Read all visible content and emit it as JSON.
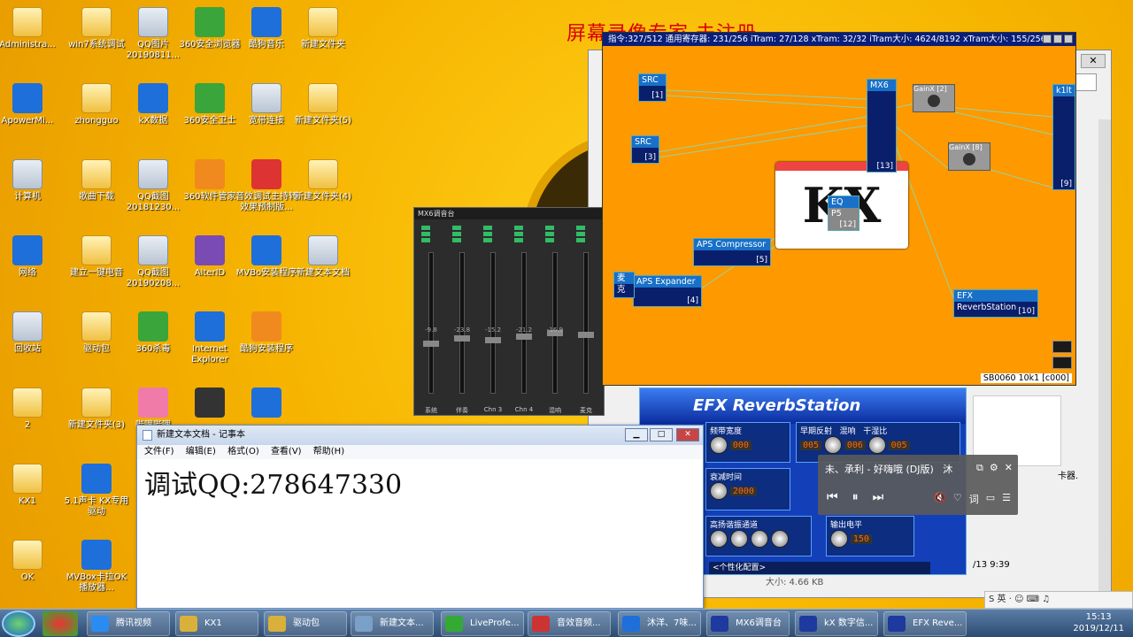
{
  "watermark": "屏幕录像专家 未注册",
  "desktop_icons": [
    {
      "label": "Administra...",
      "icon": "user-folder-icon"
    },
    {
      "label": "win7系统调试",
      "icon": "folder-icon"
    },
    {
      "label": "QQ图片20190811...",
      "icon": "image-file-icon"
    },
    {
      "label": "360安全浏览器",
      "icon": "browser-icon"
    },
    {
      "label": "酷狗音乐",
      "icon": "music-app-icon"
    },
    {
      "label": "新建文件夹",
      "icon": "folder-icon"
    },
    {
      "label": "ApowerMi...",
      "icon": "mirror-app-icon"
    },
    {
      "label": "zhongguo",
      "icon": "folder-icon"
    },
    {
      "label": "kX数据",
      "icon": "kx-icon"
    },
    {
      "label": "360安全卫士",
      "icon": "security-icon"
    },
    {
      "label": "宽带连接",
      "icon": "network-icon"
    },
    {
      "label": "新建文件夹(5)",
      "icon": "folder-icon"
    },
    {
      "label": "计算机",
      "icon": "computer-icon"
    },
    {
      "label": "歌曲下载",
      "icon": "folder-icon"
    },
    {
      "label": "QQ截图20181230...",
      "icon": "image-file-icon"
    },
    {
      "label": "360软件管家",
      "icon": "software-manager-icon"
    },
    {
      "label": "音效调试主持转效果预制版...",
      "icon": "audio-app-icon"
    },
    {
      "label": "新建文件夹(4)",
      "icon": "folder-icon"
    },
    {
      "label": "网络",
      "icon": "globe-icon"
    },
    {
      "label": "建立一键电音",
      "icon": "folder-icon"
    },
    {
      "label": "QQ截图20190208...",
      "icon": "image-file-icon"
    },
    {
      "label": "AlterID",
      "icon": "alterid-icon"
    },
    {
      "label": "MVBo安装程序",
      "icon": "installer-icon"
    },
    {
      "label": "新建文本文档",
      "icon": "text-file-icon"
    },
    {
      "label": "回收站",
      "icon": "recycle-bin-icon"
    },
    {
      "label": "驱动包",
      "icon": "folder-icon"
    },
    {
      "label": "360杀毒",
      "icon": "antivirus-icon"
    },
    {
      "label": "Internet Explorer",
      "icon": "ie-icon"
    },
    {
      "label": "酷狗安装程序",
      "icon": "package-icon"
    },
    {
      "label": "2",
      "icon": "folder-icon"
    },
    {
      "label": "新建文件夹(3)",
      "icon": "folder-icon"
    },
    {
      "label": "哔哩哔哩",
      "icon": "bilibili-icon"
    },
    {
      "label": "",
      "icon": "media-icon"
    },
    {
      "label": "",
      "icon": "download-icon"
    },
    {
      "label": "KX1",
      "icon": "folder-icon"
    },
    {
      "label": "5.1声卡 KX专用驱动",
      "icon": "installer-icon"
    },
    {
      "label": "OK",
      "icon": "folder-icon"
    },
    {
      "label": "MVBox卡拉OK播放器...",
      "icon": "installer-icon"
    }
  ],
  "kx_dsp": {
    "status_bar": "指令:327/512 通用寄存器: 231/256 iTram: 27/128 xTram: 32/32 iTram大小: 4624/8192 xTram大小: 155/256",
    "footer": "SB0060 10k1 [c000]",
    "logo": "KX",
    "modules": [
      {
        "title": "SRC",
        "num": "[1]"
      },
      {
        "title": "SRC",
        "num": "[3]"
      },
      {
        "title": "MX6",
        "num": "[13]"
      },
      {
        "title": "GainX [2]",
        "num": ""
      },
      {
        "title": "GainX [8]",
        "num": ""
      },
      {
        "title": "k1lt",
        "num": "[9]"
      },
      {
        "title": "EQ P5",
        "num": "[12]"
      },
      {
        "title": "APS Compressor",
        "num": "[5]"
      },
      {
        "title": "APS Expander",
        "num": "[4]"
      },
      {
        "title": "麦克",
        "num": ""
      },
      {
        "title": "EFX ReverbStation",
        "num": "[10]"
      }
    ]
  },
  "mx6": {
    "title": "MX6调音台",
    "channels": [
      "系统",
      "伴奏",
      "Chn 3",
      "Chn 4",
      "混响",
      "麦克"
    ],
    "values": [
      "-9.8",
      "-23.8",
      "-15.2",
      "-21.2",
      "-16.9",
      ""
    ]
  },
  "efx": {
    "title": "EFX ReverbStation",
    "panels": [
      "频带宽度",
      "早期反射",
      "混响",
      "干湿比",
      "衰减时间",
      "高扬谐振通道",
      "输出电平"
    ],
    "lcd": [
      "000",
      "005",
      "006",
      "005",
      "2000",
      "150"
    ],
    "footer": "<个性化配置>"
  },
  "notepad": {
    "title": "新建文本文档 - 记事本",
    "menu": [
      "文件(F)",
      "编辑(E)",
      "格式(O)",
      "查看(V)",
      "帮助(H)"
    ],
    "content": "调试QQ:278647330"
  },
  "explorer": {
    "text1": "卡器.",
    "text2": "/13 9:39",
    "size": "大小: 4.66 KB"
  },
  "player": {
    "song": "未、承利 - 好嗨哦 (DJ版)",
    "extra": "沐"
  },
  "taskbar": {
    "items": [
      "腾讯视频",
      "KX1",
      "驱动包",
      "新建文本...",
      "LiveProfe...",
      "音效音频...",
      "沐洋、7味...",
      "MX6调音台",
      "kX 数字信...",
      "EFX Reve..."
    ],
    "time": "15:13",
    "date": "2019/12/11",
    "ime": "英"
  },
  "colors": {
    "dsp_bg": "#ff9900",
    "dsp_title": "#0a1f7a",
    "taskbar": "#2c4b72"
  }
}
